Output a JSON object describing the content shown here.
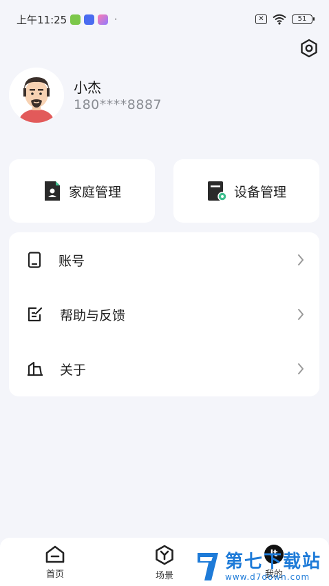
{
  "status_bar": {
    "time": "上午11:25",
    "dot": "·",
    "sim": "✕",
    "battery": "51"
  },
  "profile": {
    "name": "小杰",
    "phone": "180****8887"
  },
  "cards": {
    "home_label": "家庭管理",
    "device_label": "设备管理"
  },
  "menu": {
    "items": [
      {
        "label": "账号",
        "icon": "phone-icon"
      },
      {
        "label": "帮助与反馈",
        "icon": "edit-note-icon"
      },
      {
        "label": "关于",
        "icon": "building-icon"
      }
    ]
  },
  "bottom_nav": {
    "items": [
      {
        "label": "首页",
        "icon": "home-icon"
      },
      {
        "label": "场景",
        "icon": "scene-icon"
      },
      {
        "label": "我的",
        "icon": "mine-icon"
      }
    ],
    "mine_badge": "lt"
  },
  "watermark": {
    "title": "第七下载站",
    "url": "www.d7down.com"
  },
  "colors": {
    "accent": "#3fbf8f",
    "background": "#f4f5fa",
    "watermark": "#1e7bd8"
  }
}
